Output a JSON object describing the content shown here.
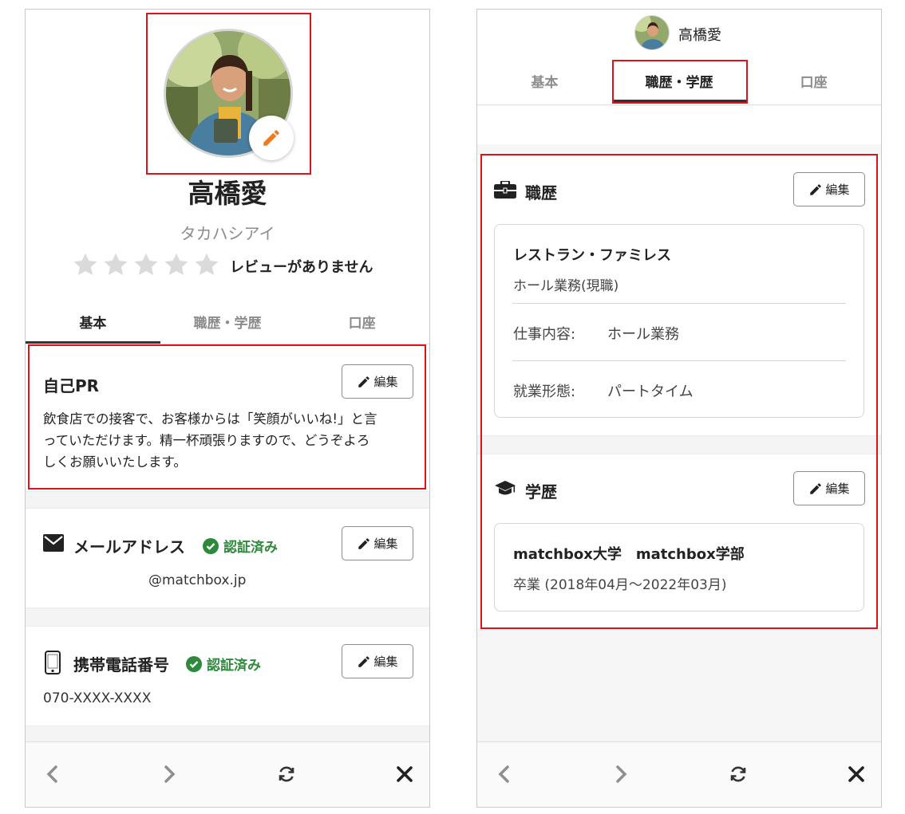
{
  "left": {
    "profile": {
      "name": "高橋愛",
      "kana": "タカハシアイ",
      "rating": 0,
      "no_review": "レビューがありません"
    },
    "tabs": [
      {
        "label": "基本"
      },
      {
        "label": "職歴・学歴"
      },
      {
        "label": "口座"
      }
    ],
    "self_pr": {
      "title": "自己PR",
      "edit": "編集",
      "lines": [
        "飲食店での接客で、お客様からは「笑顔がいいね!」と言",
        "っていただけます。精一杯頑張りますので、どうぞよろ",
        "しくお願いいたします。"
      ]
    },
    "email": {
      "title": "メールアドレス",
      "verified": "認証済み",
      "edit": "編集",
      "value": "@matchbox.jp"
    },
    "phone": {
      "title": "携帯電話番号",
      "verified": "認証済み",
      "edit": "編集",
      "value": "070-XXXX-XXXX"
    }
  },
  "right": {
    "header": {
      "name": "高橋愛"
    },
    "tabs": [
      {
        "label": "基本"
      },
      {
        "label": "職歴・学歴"
      },
      {
        "label": "口座"
      }
    ],
    "career": {
      "title": "職歴",
      "edit": "編集",
      "company": "レストラン・ファミレス",
      "position": "ホール業務(現職)",
      "rows": [
        {
          "label": "仕事内容:",
          "value": "ホール業務"
        },
        {
          "label": "就業形態:",
          "value": "パートタイム"
        }
      ]
    },
    "education": {
      "title": "学歴",
      "edit": "編集",
      "school": "matchbox大学　matchbox学部",
      "detail": "卒業 (2018年04月〜2022年03月)"
    }
  },
  "colors": {
    "accent_orange": "#f07a1b",
    "verified_green": "#2c8a3a",
    "highlight_red": "#d9151b"
  }
}
